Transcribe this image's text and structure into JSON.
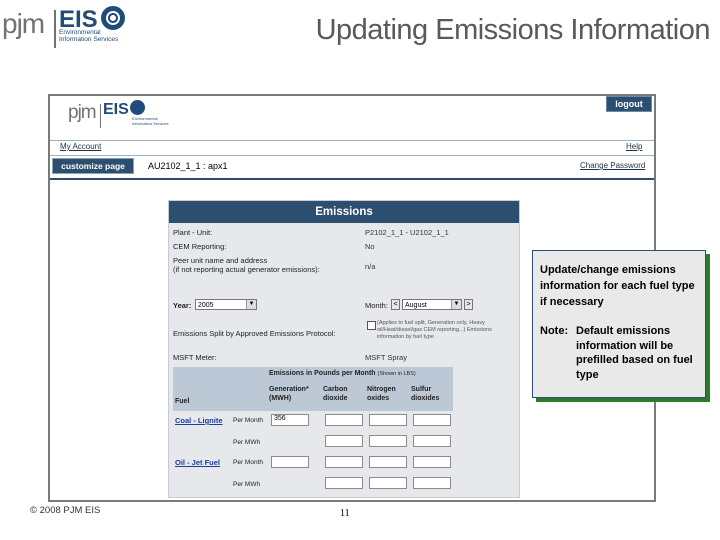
{
  "slide": {
    "logo_pjm": "pjm",
    "logo_eis": "EIS",
    "logo_sub": "Environmental Information Services",
    "title": "Updating Emissions Information",
    "copyright": "© 2008 PJM EIS",
    "page_number": "11"
  },
  "app": {
    "logo_pjm": "pjm",
    "logo_eis": "EIS",
    "logo_sub": "Environmental Information Services",
    "logout_label": "logout",
    "my_account_label": "My Account",
    "help_label": "Help",
    "customize_label": "customize page",
    "unit_id": "AU2102_1_1 : apx1",
    "change_password_label": "Change Password"
  },
  "form": {
    "title": "Emissions",
    "plant_unit_label": "Plant - Unit:",
    "plant_unit_value": "P2102_1_1 - U2102_1_1",
    "cem_label": "CEM Reporting:",
    "cem_value": "No",
    "peer_label": "Peer unit name and address",
    "peer_label2": "(if not reporting actual generator emissions):",
    "peer_value": "n/a",
    "year_label": "Year:",
    "year_value": "2005",
    "month_label": "Month:",
    "month_prev": "<",
    "month_value": "August",
    "month_next": ">",
    "split_label": "Emissions Split by Approved Emissions Protocol:",
    "split_text": "(Applies to fuel split, Generation only, Heavy oil/Heat/diesel/gas CEM reporting...) Emissions information by fuel type",
    "msft_label": "MSFT Meter:",
    "msft_value": "MSFT Spray",
    "emissions_header": "Emissions in Pounds per Month",
    "emissions_header_note": "(Shown in LBS)",
    "fuel_col": "Fuel",
    "columns": [
      "Generation* (MWH)",
      "Carbon dioxide",
      "Nitrogen oxides",
      "Sulfur dioxides"
    ],
    "rows": [
      {
        "fuel": "Coal - Lignite",
        "basis": "Per Month",
        "values": [
          "356",
          "",
          "",
          ""
        ]
      },
      {
        "fuel": "",
        "basis": "Per MWh",
        "values": [
          "",
          "",
          "",
          ""
        ]
      },
      {
        "fuel": "Oil - Jet Fuel",
        "basis": "Per Month",
        "values": [
          "",
          "",
          "",
          ""
        ]
      },
      {
        "fuel": "",
        "basis": "Per MWh",
        "values": [
          "",
          "",
          "",
          ""
        ]
      }
    ]
  },
  "callout": {
    "text": "Update/change emissions information for each fuel type if necessary",
    "note_label": "Note:",
    "note_text": "Default emissions information will be prefilled based on fuel type"
  },
  "colors": {
    "brand_navy": "#1f4c7a",
    "header_bar": "#2c4f6f",
    "callout_shadow": "#2b7b2b",
    "link": "#1a3d9e"
  }
}
